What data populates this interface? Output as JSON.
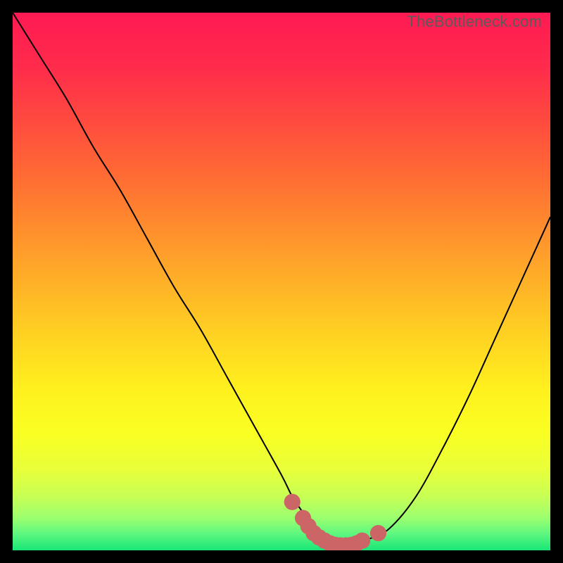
{
  "watermark": "TheBottleneck.com",
  "colors": {
    "black": "#000000",
    "curve": "#000000",
    "marker_fill": "#cc6666",
    "marker_stroke": "#cc6666"
  },
  "gradient_stops": [
    {
      "offset": 0.0,
      "color": "#ff1a53"
    },
    {
      "offset": 0.1,
      "color": "#ff2b4b"
    },
    {
      "offset": 0.2,
      "color": "#ff4a3f"
    },
    {
      "offset": 0.3,
      "color": "#ff6a34"
    },
    {
      "offset": 0.4,
      "color": "#ff8d2d"
    },
    {
      "offset": 0.5,
      "color": "#ffb028"
    },
    {
      "offset": 0.6,
      "color": "#ffd222"
    },
    {
      "offset": 0.7,
      "color": "#fff01e"
    },
    {
      "offset": 0.78,
      "color": "#faff22"
    },
    {
      "offset": 0.85,
      "color": "#e8ff3a"
    },
    {
      "offset": 0.9,
      "color": "#c7ff55"
    },
    {
      "offset": 0.94,
      "color": "#9bff6f"
    },
    {
      "offset": 0.97,
      "color": "#5cf77f"
    },
    {
      "offset": 1.0,
      "color": "#18e677"
    }
  ],
  "chart_data": {
    "type": "line",
    "title": "",
    "xlabel": "",
    "ylabel": "",
    "xlim": [
      0,
      100
    ],
    "ylim": [
      0,
      100
    ],
    "series": [
      {
        "name": "bottleneck-curve",
        "x": [
          0,
          5,
          10,
          15,
          20,
          25,
          30,
          35,
          40,
          45,
          50,
          52,
          54,
          56,
          58,
          60,
          62,
          64,
          66,
          70,
          75,
          80,
          85,
          90,
          95,
          100
        ],
        "y": [
          100,
          92,
          84,
          75,
          67,
          58,
          49,
          41,
          32,
          23,
          14,
          10,
          7,
          4,
          2,
          1,
          1,
          1,
          2,
          4,
          10,
          19,
          29,
          40,
          51,
          62
        ]
      }
    ],
    "markers": [
      {
        "x": 52,
        "y": 9,
        "r": 1.6
      },
      {
        "x": 54,
        "y": 6,
        "r": 1.6
      },
      {
        "x": 55,
        "y": 4.5,
        "r": 1.6
      },
      {
        "x": 56,
        "y": 3.2,
        "r": 1.6
      },
      {
        "x": 57,
        "y": 2.4,
        "r": 1.6
      },
      {
        "x": 58,
        "y": 1.8,
        "r": 1.6
      },
      {
        "x": 59,
        "y": 1.3,
        "r": 1.6
      },
      {
        "x": 60,
        "y": 1.0,
        "r": 1.6
      },
      {
        "x": 61,
        "y": 0.9,
        "r": 1.6
      },
      {
        "x": 62,
        "y": 0.9,
        "r": 1.6
      },
      {
        "x": 63,
        "y": 1.0,
        "r": 1.6
      },
      {
        "x": 64,
        "y": 1.3,
        "r": 1.6
      },
      {
        "x": 65,
        "y": 1.8,
        "r": 1.6
      },
      {
        "x": 68,
        "y": 3.2,
        "r": 1.6
      }
    ]
  }
}
